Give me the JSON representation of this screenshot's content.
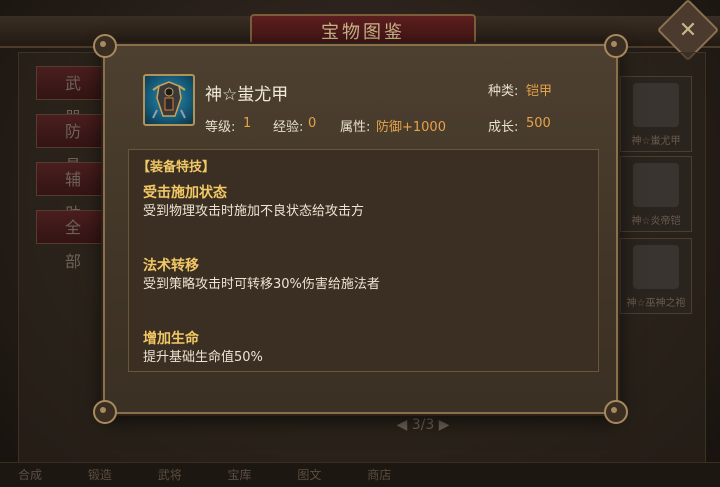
{
  "background": {
    "title": "宝物图鉴",
    "close_label": "✕",
    "side_tabs": [
      "武器",
      "防具",
      "辅助",
      "全部"
    ],
    "cards": [
      {
        "label": "神☆蚩尤甲"
      },
      {
        "label": "神☆炎帝铠"
      },
      {
        "label": "神☆巫神之袍"
      }
    ],
    "pager": "3/3",
    "bottom_tabs": [
      "合成",
      "锻造",
      "武将",
      "宝库",
      "图文",
      "商店"
    ]
  },
  "item": {
    "icon": "armor-icon",
    "name": "神☆蚩尤甲",
    "category_label": "种类:",
    "category_value": "铠甲",
    "level_label": "等级:",
    "level_value": "1",
    "exp_label": "经验:",
    "exp_value": "0",
    "attr_label": "属性:",
    "attr_value": "防御+1000",
    "growth_label": "成长:",
    "growth_value": "500"
  },
  "skills": {
    "header": "【装备特技】",
    "list": [
      {
        "name": "受击施加状态",
        "desc": "受到物理攻击时施加不良状态给攻击方"
      },
      {
        "name": "法术转移",
        "desc": "受到策略攻击时可转移30%伤害给施法者"
      },
      {
        "name": "增加生命",
        "desc": "提升基础生命值50%"
      }
    ]
  },
  "colors": {
    "accent_orange": "#e8a24a",
    "skill_gold": "#f2c866",
    "frame": "#8a6f4a"
  }
}
